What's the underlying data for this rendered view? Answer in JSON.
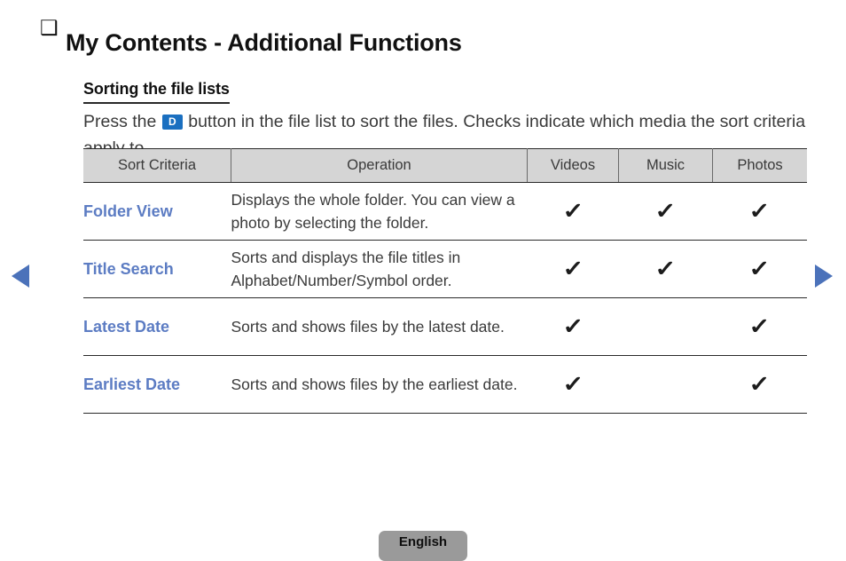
{
  "header": {
    "bullet_icon": "❑",
    "title": "My Contents - Additional Functions",
    "subtitle": "Sorting the file lists"
  },
  "intro": {
    "text_before": "Press the",
    "key_badge": "D",
    "text_after": "button in the file list to sort the files. Checks indicate which media the sort criteria apply to."
  },
  "table": {
    "columns": [
      "Sort Criteria",
      "Operation",
      "Videos",
      "Music",
      "Photos"
    ],
    "rows": [
      {
        "criteria": "Folder View",
        "operation": "Displays the whole folder. You can view a photo by selecting the folder.",
        "videos": "✓",
        "music": "✓",
        "photos": "✓"
      },
      {
        "criteria": "Title Search",
        "operation": "Sorts and displays the file titles in Alphabet/Number/Symbol order.",
        "videos": "✓",
        "music": "✓",
        "photos": "✓"
      },
      {
        "criteria": "Latest Date",
        "operation": "Sorts and shows files by the latest date.",
        "videos": "✓",
        "music": "",
        "photos": "✓"
      },
      {
        "criteria": "Earliest Date",
        "operation": "Sorts and shows files by the earliest date.",
        "videos": "✓",
        "music": "",
        "photos": "✓"
      }
    ]
  },
  "navigation": {
    "prev_label": "previous-page",
    "next_label": "next-page"
  },
  "footer": {
    "language_label": "English"
  },
  "colors": {
    "accent_blue": "#5c7cc3",
    "key_badge_blue": "#1a6fc0",
    "arrow_blue": "#4b72ba",
    "header_gray": "#d5d5d5",
    "button_gray": "#9a9a9a"
  }
}
